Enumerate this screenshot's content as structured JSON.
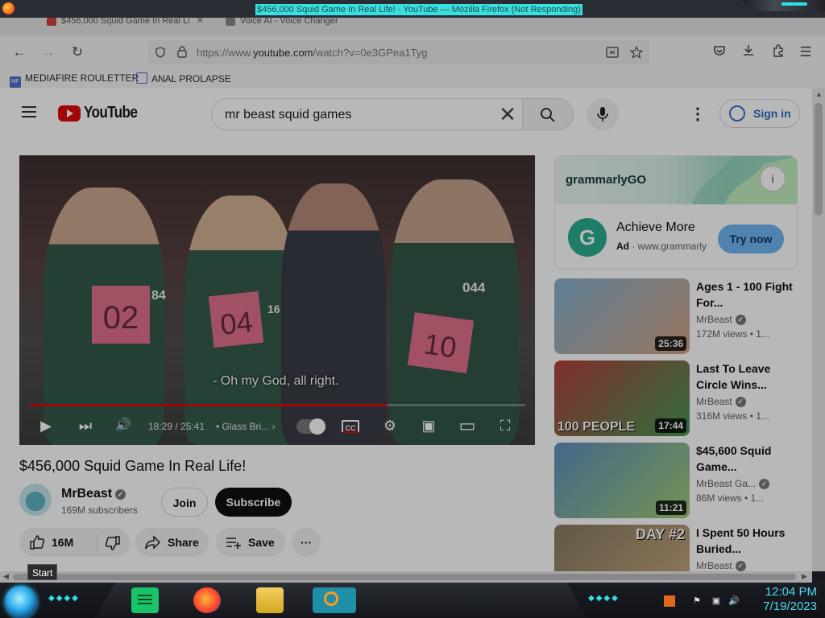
{
  "window": {
    "title": "$456,000 Squid Game In Real Life! - YouTube — Mozilla Firefox (Not Responding)"
  },
  "tabs": [
    {
      "label": "$456,000 Squid Game In Real Li",
      "close": "✕"
    },
    {
      "label": "Voice AI - Voice Changer"
    }
  ],
  "toolbar": {
    "back_icon": "←",
    "forward_icon": "→",
    "reload_icon": "↻",
    "url_prefix": "https://www.",
    "url_domain": "youtube.com",
    "url_path": "/watch?v=0e3GPea1Tyg",
    "pocket_icon": "pocket-icon",
    "downloads_icon": "download-icon",
    "extensions_icon": "puzzle-icon",
    "menu_icon": "☰"
  },
  "bookmarks": [
    {
      "label": "MEDIAFIRE ROULETTER",
      "icon_text": "MF"
    },
    {
      "label": "ANAL PROLAPSE",
      "icon_text": ""
    }
  ],
  "youtube": {
    "logo_text": "YouTube",
    "search_query": "mr beast squid games",
    "clear_icon": "✕",
    "more_icon": "⋮",
    "sign_in": "Sign in"
  },
  "player": {
    "subtitle": "- Oh my God, all right.",
    "time": "18:29 / 25:41",
    "chapter": "• Glass Bri...",
    "chapter_arrow": "›",
    "progress": 0.72,
    "bibs": [
      "02",
      "04",
      "10"
    ],
    "numbers": [
      "84",
      "16",
      "044"
    ],
    "play_icon": "▶",
    "next_icon": "⏭",
    "volume_icon": "🔊",
    "cc_label": "CC",
    "settings_icon": "⚙",
    "miniplayer_icon": "▣",
    "theater_icon": "▭",
    "fullscreen_icon": "⛶"
  },
  "video": {
    "title": "$456,000 Squid Game In Real Life!",
    "channel": "MrBeast",
    "verified": "✓",
    "subscribers": "169M subscribers",
    "join": "Join",
    "subscribe": "Subscribe",
    "likes": "16M",
    "share": "Share",
    "save": "Save",
    "more": "···"
  },
  "ad": {
    "brand": "grammarlyGO",
    "info_icon": "i",
    "logo_letter": "G",
    "headline": "Achieve More",
    "ad_label": "Ad",
    "domain": "· www.grammarly",
    "cta": "Try now"
  },
  "recommendations": [
    {
      "title": "Ages 1 - 100 Fight For...",
      "channel": "MrBeast",
      "meta": "172M views • 1...",
      "duration": "25:36",
      "thumb_colors": [
        "#7fb3d9",
        "#d9a27a"
      ]
    },
    {
      "title": "Last To Leave Circle Wins...",
      "channel": "MrBeast",
      "meta": "316M views • 1...",
      "duration": "17:44",
      "overlay": "100 PEOPLE",
      "thumb_colors": [
        "#c23b3b",
        "#3b9c4a"
      ]
    },
    {
      "title": "$45,600 Squid Game...",
      "channel": "MrBeast Ga...",
      "meta": "86M views • 1...",
      "duration": "11:21",
      "thumb_colors": [
        "#5a8fc8",
        "#9ad06a"
      ]
    },
    {
      "title": "I Spent 50 Hours Buried...",
      "channel": "MrBeast",
      "meta": "",
      "duration": "",
      "overlay": "DAY #2",
      "thumb_colors": [
        "#8c7a5a",
        "#c9a979"
      ]
    }
  ],
  "tooltip": "Start",
  "taskbar": {
    "time": "12:04 PM",
    "date": "7/19/2023"
  },
  "colors": {
    "accent_red": "#ff0000",
    "link_blue": "#1f6fd6",
    "taskbar_cyan": "#2de2e6"
  }
}
